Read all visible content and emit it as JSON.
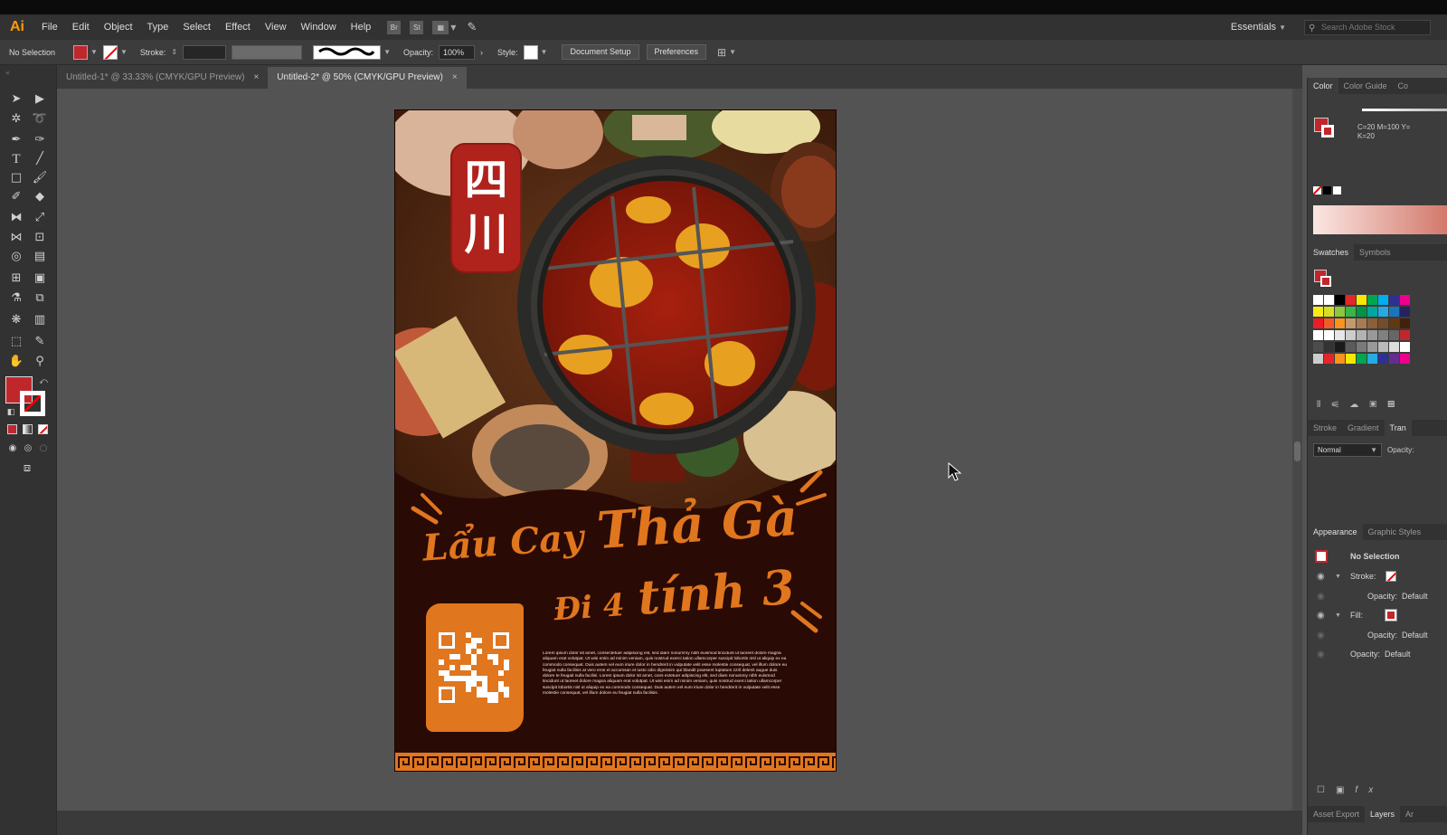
{
  "app": {
    "logo": "Ai",
    "menus": [
      "File",
      "Edit",
      "Object",
      "Type",
      "Select",
      "Effect",
      "View",
      "Window",
      "Help"
    ],
    "bridge_icons": [
      "Br",
      "St"
    ],
    "workspace": "Essentials",
    "search_placeholder": "Search Adobe Stock"
  },
  "control_bar": {
    "selection_label": "No Selection",
    "stroke_label": "Stroke:",
    "opacity_label": "Opacity:",
    "opacity_value": "100%",
    "style_label": "Style:",
    "document_setup": "Document Setup",
    "preferences": "Preferences"
  },
  "tabs": [
    {
      "label": "Untitled-1* @ 33.33% (CMYK/GPU Preview)",
      "active": false
    },
    {
      "label": "Untitled-2* @ 50% (CMYK/GPU Preview)",
      "active": true
    }
  ],
  "artboard": {
    "badge_line1": "四",
    "badge_line2": "川",
    "headline_line1_a": "Lẩu Cay",
    "headline_line1_b": "Thả Gà",
    "headline_line2_a": "Đi 4",
    "headline_line2_b": "tính 3",
    "body_text": "Lorem ipsum dolor sit amet, consectetuer adipiscing elit, sed diam nonummy nibh euismod tincidunt ut laoreet dolore magna aliquam erat volutpat. Ut wisi enim ad minim veniam, quis nostrud exerci tation ullamcorper suscipit lobortis nisl ut aliquip ex ea commodo consequat. Duis autem vel eum iriure dolor in hendrerit in vulputate velit esse molestie consequat, vel illum dolore eu feugiat nulla facilisis at vero eros et accumsan et iusto odio dignissim qui blandit praesent luptatum zzril delenit augue duis dolore te feugait nulla facilisi. Lorem ipsum dolor sit amet, cons ectetuer adipiscing elit, sed diam nonummy nibh euismod tincidunt ut laoreet dolore magna aliquam erat volutpat. Ut wisi enim ad minim veniam, quis nostrud exerci tation ullamcorper suscipit lobortis nisl ut aliquip ex ea commodo consequat. Duis autem vel eum iriure dolor in hendrerit in vulputate velit esse molestie consequat, vel illum dolore eu feugiat nulla facilisis."
  },
  "color_panel": {
    "tabs": [
      "Color",
      "Color Guide",
      "Co"
    ],
    "cmyk_line1": "C=20 M=100 Y=",
    "cmyk_line2": "K=20"
  },
  "swatches_panel": {
    "tabs": [
      "Swatches",
      "Symbols"
    ]
  },
  "stroke_panel": {
    "tabs": [
      "Stroke",
      "Gradient",
      "Tran"
    ],
    "blend_mode": "Normal",
    "opacity_label": "Opacity:"
  },
  "appearance_panel": {
    "tabs": [
      "Appearance",
      "Graphic Styles"
    ],
    "title": "No Selection",
    "stroke_label": "Stroke:",
    "opacity1": "Opacity:",
    "opacity1_value": "Default",
    "fill_label": "Fill:",
    "opacity2": "Opacity:",
    "opacity2_value": "Default",
    "opacity3": "Opacity:",
    "opacity3_value": "Default"
  },
  "bottom_tabs": [
    "Asset Export",
    "Layers",
    "Ar"
  ],
  "colors": {
    "accent_red": "#c0272d",
    "poster_orange": "#e0761e",
    "poster_bg": "#2a0a05",
    "app_bg": "#535353"
  }
}
